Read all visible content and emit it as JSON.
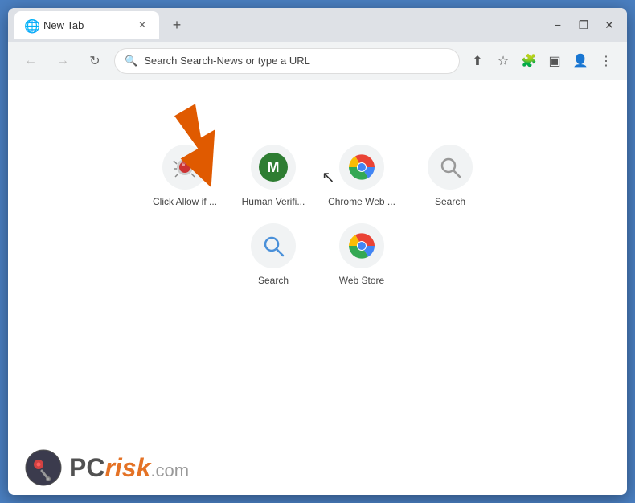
{
  "window": {
    "title": "New Tab",
    "minimize_label": "−",
    "restore_label": "❐",
    "close_label": "✕"
  },
  "tab": {
    "favicon": "🌐",
    "title": "New Tab",
    "close_icon": "✕"
  },
  "new_tab_button": "+",
  "toolbar": {
    "back_icon": "←",
    "forward_icon": "→",
    "refresh_icon": "↻",
    "address_placeholder": "Search Search-News or type a URL",
    "address_value": "Search Search-News or type a URL",
    "share_icon": "⬆",
    "bookmark_icon": "☆",
    "extension_icon": "🧩",
    "sidebar_icon": "▣",
    "profile_icon": "👤",
    "menu_icon": "⋮"
  },
  "shortcuts": {
    "row1": [
      {
        "label": "Click Allow if ...",
        "icon_type": "bug"
      },
      {
        "label": "Human Verifi...",
        "icon_type": "m"
      },
      {
        "label": "Chrome Web ...",
        "icon_type": "chrome"
      },
      {
        "label": "Search",
        "icon_type": "search_grey"
      }
    ],
    "row2": [
      {
        "label": "Search",
        "icon_type": "search_blue"
      },
      {
        "label": "Web Store",
        "icon_type": "chrome2"
      }
    ]
  },
  "watermark": {
    "pc": "PC",
    "risk": "risk",
    "com": ".com"
  },
  "arrow": {
    "color": "#e05a00"
  }
}
